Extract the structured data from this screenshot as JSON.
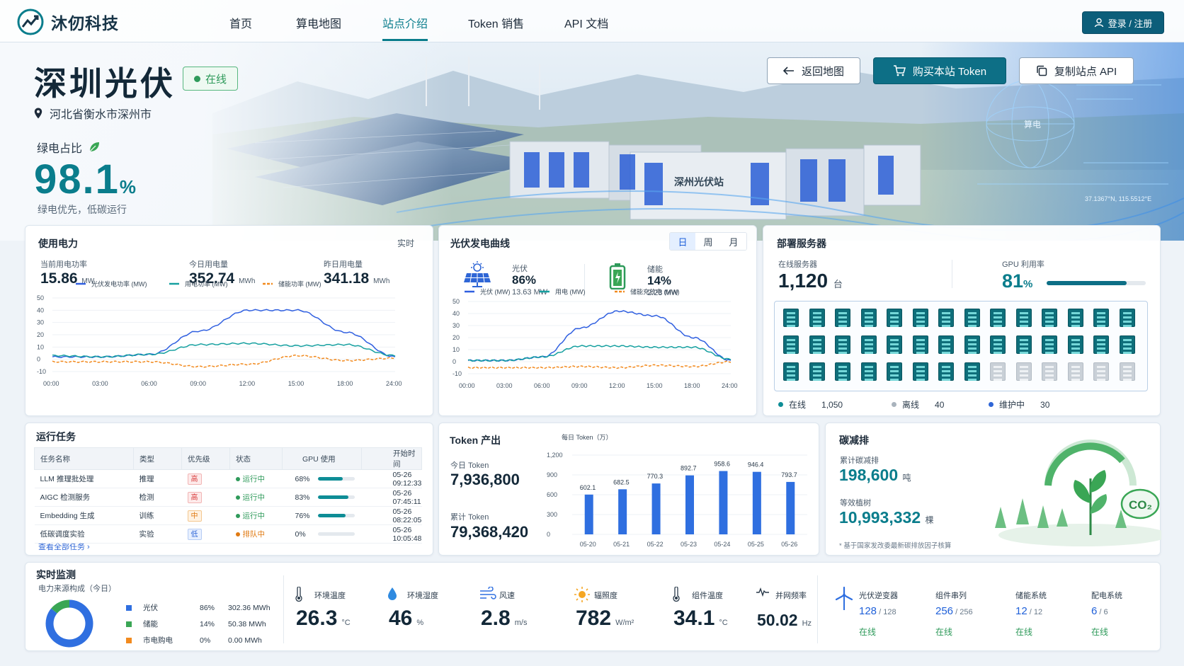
{
  "app": {
    "brand": "沐仞科技",
    "nav": [
      "首页",
      "算电地图",
      "站点介绍",
      "Token 销售",
      "API 文档"
    ],
    "active_nav": 2,
    "login": "登录 / 注册"
  },
  "site": {
    "name": "深圳光伏",
    "status": "在线",
    "location": "河北省衡水市深州市",
    "green_label": "绿电占比",
    "green_value": "98.1",
    "green_unit": "%",
    "green_sub": "绿电优先，低碳运行",
    "building_label": "深州光伏站",
    "coord": "37.1367°N, 115.5512°E",
    "globe_label": "算电"
  },
  "actions": {
    "back": "返回地图",
    "buy": "购买本站 Token",
    "copy": "复制站点 API"
  },
  "power": {
    "title": "使用电力",
    "tag": "实时",
    "stats": [
      {
        "label": "当前用电功率",
        "value": "15.86",
        "unit": "MW"
      },
      {
        "label": "今日用电量",
        "value": "352.74",
        "unit": "MWh"
      },
      {
        "label": "昨日用电量",
        "value": "341.18",
        "unit": "MWh"
      }
    ],
    "legend": [
      "光伏发电功率 (MW)",
      "用电功率 (MW)",
      "储能功率 (MW)"
    ]
  },
  "pv": {
    "title": "光伏发电曲线",
    "tabs": [
      "日",
      "周",
      "月"
    ],
    "active_tab": 0,
    "stats": [
      {
        "label": "光伏",
        "pct": "86%",
        "value": "13.63 MW"
      },
      {
        "label": "储能",
        "pct": "14%",
        "value": "2.23 MW"
      }
    ],
    "legend": [
      "光伏 (MW)",
      "用电 (MW)",
      "储能充放电 (MW)"
    ]
  },
  "servers": {
    "title": "部署服务器",
    "online_label": "在线服务器",
    "online_value": "1,120",
    "online_unit": "台",
    "gpu_label": "GPU 利用率",
    "gpu_value": "81",
    "gpu_unit": "%",
    "gpu_fraction": 0.81,
    "legend": [
      {
        "label": "在线",
        "count": "1,050",
        "color": "#0e8d96"
      },
      {
        "label": "离线",
        "count": "40",
        "color": "#a9b3bd"
      },
      {
        "label": "维护中",
        "count": "30",
        "color": "#2f66d6"
      }
    ],
    "rack_online": 36,
    "rack_total": 42
  },
  "tasks": {
    "title": "运行任务",
    "headers": [
      "任务名称",
      "类型",
      "优先级",
      "状态",
      "GPU 使用",
      "开始时间"
    ],
    "rows": [
      {
        "name": "LLM 推理批处理",
        "type": "推理",
        "pri": "高",
        "pcls": "h",
        "status": "运行中",
        "scolor": "#2e9a5a",
        "gpu": "68%",
        "gfrac": 0.68,
        "time": "05-26 09:12:33"
      },
      {
        "name": "AIGC 检测服务",
        "type": "检测",
        "pri": "高",
        "pcls": "h",
        "status": "运行中",
        "scolor": "#2e9a5a",
        "gpu": "83%",
        "gfrac": 0.83,
        "time": "05-26 07:45:11"
      },
      {
        "name": "Embedding 生成",
        "type": "训练",
        "pri": "中",
        "pcls": "m",
        "status": "运行中",
        "scolor": "#2e9a5a",
        "gpu": "76%",
        "gfrac": 0.76,
        "time": "05-26 08:22:05"
      },
      {
        "name": "低碳调度实验",
        "type": "实验",
        "pri": "低",
        "pcls": "l",
        "status": "排队中",
        "scolor": "#e07a12",
        "gpu": "0%",
        "gfrac": 0,
        "time": "05-26 10:05:48"
      }
    ],
    "view_all": "查看全部任务"
  },
  "token": {
    "title": "Token 产出",
    "today_label": "今日 Token",
    "today_value": "7,936,800",
    "total_label": "累计 Token",
    "total_value": "79,368,420"
  },
  "carbon": {
    "title": "碳减排",
    "cum_label": "累计碳减排",
    "cum_value": "198,600",
    "cum_unit": "吨",
    "tree_label": "等效植树",
    "tree_value": "10,993,332",
    "tree_unit": "棵",
    "note": "* 基于国家发改委最新碳排放因子核算",
    "co2": "CO₂"
  },
  "monitor": {
    "title": "实时监测",
    "donut_title": "电力来源构成（今日）",
    "sources": [
      {
        "name": "光伏",
        "pct": "86%",
        "value": "302.36 MWh",
        "color": "#2f6fe0",
        "frac": 0.86
      },
      {
        "name": "储能",
        "pct": "14%",
        "value": "50.38 MWh",
        "color": "#3aa655",
        "frac": 0.14
      },
      {
        "name": "市电购电",
        "pct": "0%",
        "value": "0.00 MWh",
        "color": "#f28a1e",
        "frac": 0
      }
    ],
    "env": [
      {
        "label": "环境温度",
        "value": "26.3",
        "unit": "°C",
        "icon": "thermometer-icon"
      },
      {
        "label": "环境湿度",
        "value": "46",
        "unit": "%",
        "icon": "droplet-icon"
      },
      {
        "label": "风速",
        "value": "2.8",
        "unit": "m/s",
        "icon": "wind-icon"
      },
      {
        "label": "辐照度",
        "value": "782",
        "unit": "W/m²",
        "icon": "sun-icon"
      },
      {
        "label": "组件温度",
        "value": "34.1",
        "unit": "°C",
        "icon": "thermometer-icon"
      },
      {
        "label": "并网频率",
        "value": "50.02",
        "unit": "Hz",
        "icon": "pulse-icon"
      }
    ],
    "devices": [
      {
        "label": "光伏逆变器",
        "value": "128",
        "total": "128",
        "status": "在线"
      },
      {
        "label": "组件串列",
        "value": "256",
        "total": "256",
        "status": "在线"
      },
      {
        "label": "储能系统",
        "value": "12",
        "total": "12",
        "status": "在线"
      },
      {
        "label": "配电系统",
        "value": "6",
        "total": "6",
        "status": "在线"
      }
    ]
  },
  "chart_data": [
    {
      "type": "line",
      "title": "使用电力",
      "x": [
        "00:00",
        "03:00",
        "06:00",
        "09:00",
        "12:00",
        "15:00",
        "18:00",
        "24:00"
      ],
      "ylim": [
        -10,
        50
      ],
      "yticks": [
        -10,
        0,
        10,
        20,
        30,
        40,
        50
      ],
      "series": [
        {
          "name": "光伏发电功率 (MW)",
          "color": "#2f5fe0",
          "values": [
            2,
            2,
            4,
            23,
            40,
            40,
            22,
            2
          ]
        },
        {
          "name": "用电功率 (MW)",
          "color": "#16a0a0",
          "values": [
            3,
            2,
            4,
            12,
            13,
            11,
            12,
            3
          ]
        },
        {
          "name": "储能功率 (MW)",
          "color": "#f28a1e",
          "values": [
            -2,
            -2,
            -2,
            -6,
            -4,
            3,
            -1,
            1
          ]
        }
      ]
    },
    {
      "type": "line",
      "title": "光伏发电曲线",
      "x": [
        "00:00",
        "03:00",
        "06:00",
        "09:00",
        "12:00",
        "15:00",
        "18:00",
        "24:00"
      ],
      "ylim": [
        -10,
        50
      ],
      "yticks": [
        -10,
        0,
        10,
        20,
        30,
        40,
        50
      ],
      "series": [
        {
          "name": "光伏 (MW)",
          "color": "#2f5fe0",
          "values": [
            1,
            1,
            4,
            28,
            42,
            38,
            20,
            1
          ]
        },
        {
          "name": "用电 (MW)",
          "color": "#16a0a0",
          "values": [
            1,
            1,
            4,
            13,
            13,
            12,
            12,
            2
          ]
        },
        {
          "name": "储能充放电 (MW)",
          "color": "#f28a1e",
          "values": [
            -5,
            -5,
            -5,
            -4,
            -5,
            -3,
            -4,
            0
          ]
        }
      ]
    },
    {
      "type": "bar",
      "title": "每日 Token（万）",
      "categories": [
        "05-20",
        "05-21",
        "05-22",
        "05-23",
        "05-24",
        "05-25",
        "05-26"
      ],
      "values": [
        602.1,
        682.5,
        770.3,
        892.7,
        958.6,
        946.4,
        793.7
      ],
      "ylim": [
        0,
        1200
      ],
      "yticks": [
        0,
        300,
        600,
        900,
        1200
      ]
    },
    {
      "type": "pie",
      "title": "电力来源构成（今日）",
      "categories": [
        "光伏",
        "储能",
        "市电购电"
      ],
      "values": [
        86,
        14,
        0
      ]
    }
  ]
}
